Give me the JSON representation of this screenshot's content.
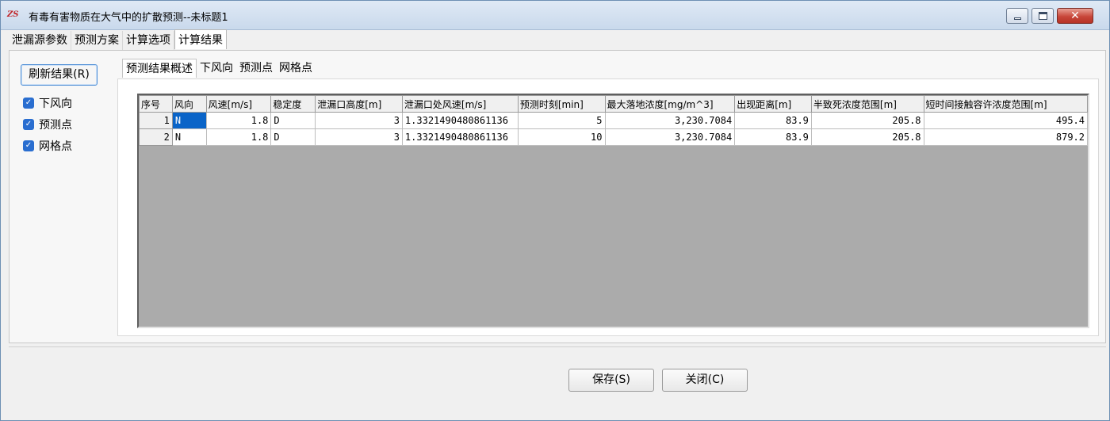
{
  "window": {
    "title": "有毒有害物质在大气中的扩散预测--未标题1",
    "icon_text": "ZS",
    "close_glyph": "✕"
  },
  "main_tabs": [
    {
      "label": "泄漏源参数"
    },
    {
      "label": "预测方案"
    },
    {
      "label": "计算选项"
    },
    {
      "label": "计算结果"
    }
  ],
  "sidebar": {
    "refresh_label": "刷新结果(R)",
    "checks": [
      {
        "label": "下风向",
        "checked": true
      },
      {
        "label": "预测点",
        "checked": true
      },
      {
        "label": "网格点",
        "checked": true
      }
    ],
    "check_glyph": "✓"
  },
  "sub_tabs": [
    {
      "label": "预测结果概述"
    },
    {
      "label": "下风向"
    },
    {
      "label": "预测点"
    },
    {
      "label": "网格点"
    }
  ],
  "table": {
    "columns": [
      "序号",
      "风向",
      "风速[m/s]",
      "稳定度",
      "泄漏口高度[m]",
      "泄漏口处风速[m/s]",
      "预测时刻[min]",
      "最大落地浓度[mg/m^3]",
      "出现距离[m]",
      "半致死浓度范围[m]",
      "短时间接触容许浓度范围[m]"
    ],
    "rows": [
      [
        "1",
        "N",
        "1.8",
        "D",
        "3",
        "1.3321490480861136",
        "5",
        "3,230.7084",
        "83.9",
        "205.8",
        "495.4"
      ],
      [
        "2",
        "N",
        "1.8",
        "D",
        "3",
        "1.3321490480861136",
        "10",
        "3,230.7084",
        "83.9",
        "205.8",
        "879.2"
      ]
    ]
  },
  "footer": {
    "save_label": "保存(S)",
    "close_label": "关闭(C)"
  },
  "colors": {
    "selection": "#0a64c8",
    "grid_background": "#ababab",
    "checkbox": "#2a6ed0"
  }
}
